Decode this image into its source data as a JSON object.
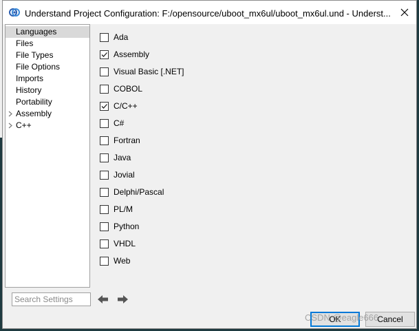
{
  "window": {
    "title": "Understand Project Configuration: F:/opensource/uboot_mx6ul/uboot_mx6ul.und - Underst...",
    "close_glyph": "✕"
  },
  "tree": {
    "items": [
      {
        "label": "Languages",
        "selected": true,
        "expandable": false
      },
      {
        "label": "Files",
        "selected": false,
        "expandable": false
      },
      {
        "label": "File Types",
        "selected": false,
        "expandable": false
      },
      {
        "label": "File Options",
        "selected": false,
        "expandable": false
      },
      {
        "label": "Imports",
        "selected": false,
        "expandable": false
      },
      {
        "label": "History",
        "selected": false,
        "expandable": false
      },
      {
        "label": "Portability",
        "selected": false,
        "expandable": false
      },
      {
        "label": "Assembly",
        "selected": false,
        "expandable": true
      },
      {
        "label": "C++",
        "selected": false,
        "expandable": true
      }
    ]
  },
  "languages": [
    {
      "label": "Ada",
      "checked": false
    },
    {
      "label": "Assembly",
      "checked": true
    },
    {
      "label": "Visual Basic [.NET]",
      "checked": false
    },
    {
      "label": "COBOL",
      "checked": false
    },
    {
      "label": "C/C++",
      "checked": true
    },
    {
      "label": "C#",
      "checked": false
    },
    {
      "label": "Fortran",
      "checked": false
    },
    {
      "label": "Java",
      "checked": false
    },
    {
      "label": "Jovial",
      "checked": false
    },
    {
      "label": "Delphi/Pascal",
      "checked": false
    },
    {
      "label": "PL/M",
      "checked": false
    },
    {
      "label": "Python",
      "checked": false
    },
    {
      "label": "VHDL",
      "checked": false
    },
    {
      "label": "Web",
      "checked": false
    }
  ],
  "search": {
    "placeholder": "Search Settings",
    "value": ""
  },
  "buttons": {
    "ok_label": "OK",
    "cancel_label": "Cancel"
  },
  "watermark": "CSDN @eagle666",
  "icons": {
    "app": "understand-app-icon",
    "back": "arrow-left-icon",
    "forward": "arrow-right-icon",
    "expander": "chevron-right-icon",
    "check": "check-icon"
  },
  "colors": {
    "accent": "#0078d7",
    "selected_row": "#d9d9d9"
  }
}
